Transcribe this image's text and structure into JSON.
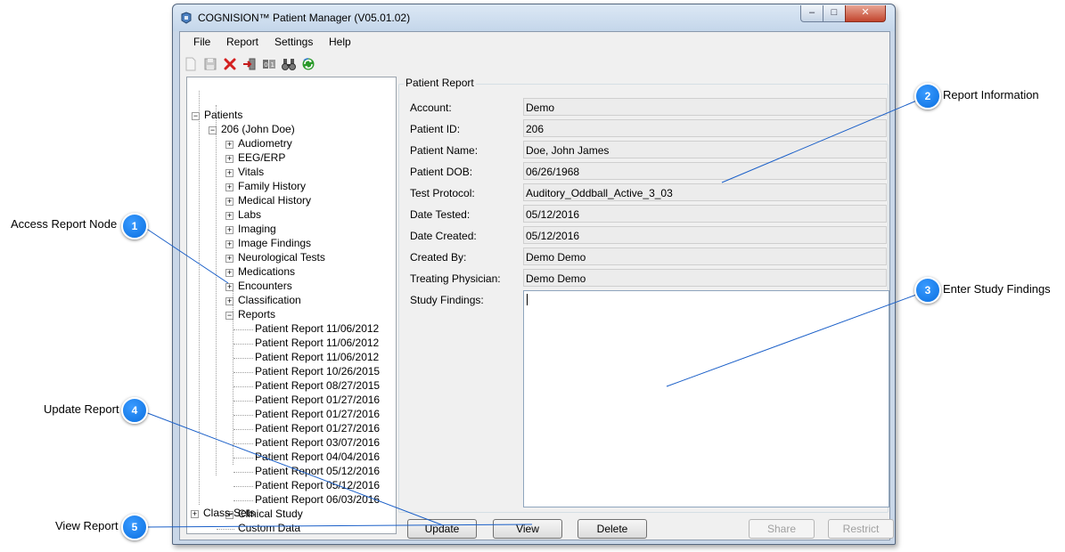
{
  "window": {
    "title": "COGNISION™ Patient Manager (V05.01.02)",
    "minimize": "‒",
    "maximize": "□",
    "close": "✕"
  },
  "menu": [
    "File",
    "Report",
    "Settings",
    "Help"
  ],
  "toolbar": [
    "new-icon",
    "save-icon",
    "delete-icon",
    "exit-icon",
    "counter-icon",
    "search-icon",
    "refresh-icon"
  ],
  "tree": {
    "root": "Patients",
    "patient": "206 (John Doe)",
    "categories": [
      "Audiometry",
      "EEG/ERP",
      "Vitals",
      "Family History",
      "Medical History",
      "Labs",
      "Imaging",
      "Image Findings",
      "Neurological Tests",
      "Medications",
      "Encounters",
      "Classification"
    ],
    "reports_node": "Reports",
    "reports": [
      "Patient Report 11/06/2012",
      "Patient Report 11/06/2012",
      "Patient Report 11/06/2012",
      "Patient Report 10/26/2015",
      "Patient Report 08/27/2015",
      "Patient Report 01/27/2016",
      "Patient Report 01/27/2016",
      "Patient Report 01/27/2016",
      "Patient Report 03/07/2016",
      "Patient Report 04/04/2016",
      "Patient Report 05/12/2016",
      "Patient Report 05/12/2016",
      "Patient Report 06/03/2016"
    ],
    "clinical_study": "Clinical Study",
    "custom_data": "Custom Data",
    "class_sets": "Class-Sets"
  },
  "report": {
    "group_title": "Patient Report",
    "fields": [
      {
        "label": "Account:",
        "value": "Demo"
      },
      {
        "label": "Patient ID:",
        "value": "206"
      },
      {
        "label": "Patient Name:",
        "value": "Doe, John James"
      },
      {
        "label": "Patient DOB:",
        "value": "06/26/1968"
      },
      {
        "label": "Test Protocol:",
        "value": "Auditory_Oddball_Active_3_03"
      },
      {
        "label": "Date Tested:",
        "value": "05/12/2016"
      },
      {
        "label": "Date Created:",
        "value": "05/12/2016"
      },
      {
        "label": "Created By:",
        "value": "Demo Demo"
      },
      {
        "label": "Treating Physician:",
        "value": "Demo Demo"
      }
    ],
    "findings_label": "Study Findings:",
    "findings_value": ""
  },
  "buttons": {
    "update": "Update",
    "view": "View",
    "delete": "Delete",
    "share": "Share",
    "restrict": "Restrict"
  },
  "callouts": [
    {
      "number": "1",
      "label": "Access Report Node"
    },
    {
      "number": "2",
      "label": "Report Information"
    },
    {
      "number": "3",
      "label": "Enter Study Findings"
    },
    {
      "number": "4",
      "label": "Update Report"
    },
    {
      "number": "5",
      "label": "View Report"
    }
  ],
  "colors": {
    "callout": "#0a6fe0",
    "window_frame": "#c9d7e8",
    "client_bg": "#f0f0f0",
    "delete_icon": "#d42020",
    "refresh_icon": "#2a9a2a"
  }
}
